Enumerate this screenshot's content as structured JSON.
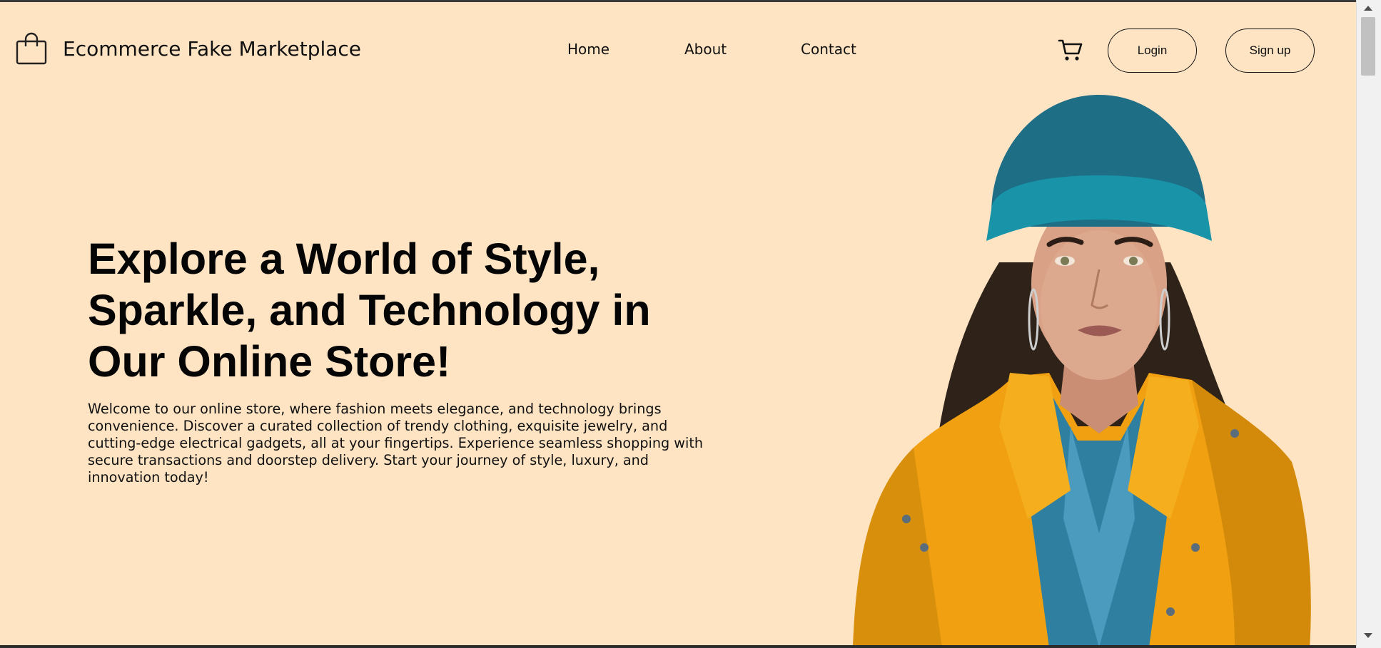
{
  "brand": {
    "title": "Ecommerce Fake Marketplace",
    "icon": "shopping-bag-icon"
  },
  "nav": {
    "home": "Home",
    "about": "About",
    "contact": "Contact"
  },
  "actions": {
    "cart_icon": "shopping-cart-icon",
    "login": "Login",
    "signup": "Sign up"
  },
  "hero": {
    "title": "Explore a World of Style, Sparkle, and Technology in Our Online Store!",
    "text": "Welcome to our online store, where fashion meets elegance, and technology brings convenience. Discover a curated collection of trendy clothing, exquisite jewelry, and cutting-edge electrical gadgets, all at your fingertips. Experience seamless shopping with secure transactions and doorstep delivery. Start your journey of style, luxury, and innovation today!",
    "image": "woman-in-yellow-jacket-and-teal-beanie"
  },
  "colors": {
    "background": "#FFE4C4",
    "text": "#111111",
    "jacket": "#F0A010",
    "beanie": "#1A8A9A"
  }
}
